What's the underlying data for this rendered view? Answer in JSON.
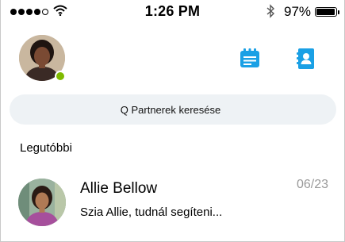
{
  "status_bar": {
    "time": "1:26 PM",
    "battery_percent": "97%",
    "signal_bars_filled": 4,
    "signal_bars_total": 5,
    "battery_level": 0.97,
    "icons": [
      "signal-icon",
      "wifi-icon",
      "bluetooth-icon",
      "battery-icon"
    ]
  },
  "header": {
    "presence_color": "#7fba00",
    "accent_color": "#1aa0e5",
    "actions": [
      {
        "icon": "schedule-icon"
      },
      {
        "icon": "contacts-icon"
      }
    ]
  },
  "search": {
    "placeholder": "Q Partnerek keresése"
  },
  "recent": {
    "title": "Legutóbbi",
    "conversations": [
      {
        "name": "Allie Bellow",
        "date": "06/23",
        "preview": "Szia Allie, tudnál segíteni..."
      }
    ]
  }
}
